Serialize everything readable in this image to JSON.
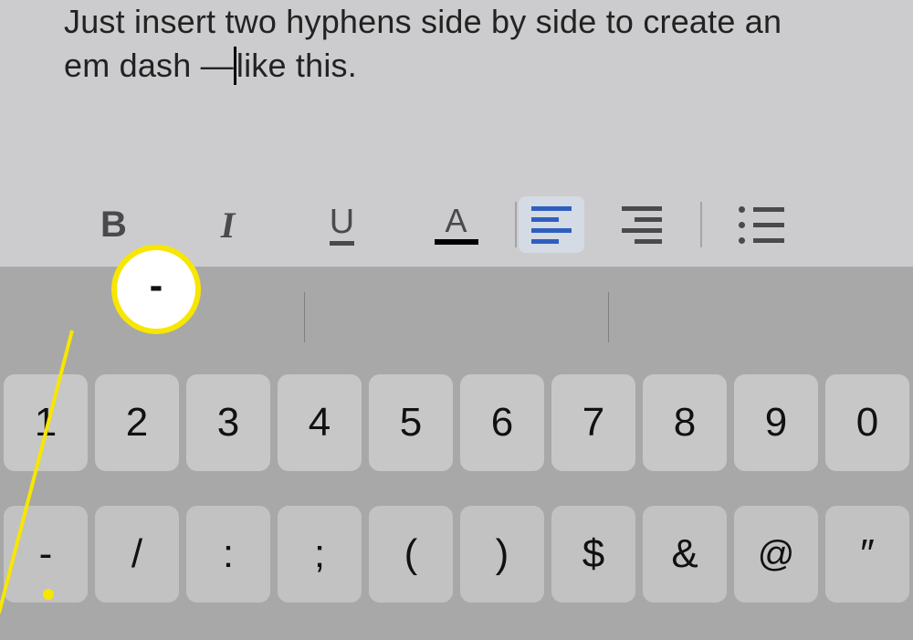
{
  "doc": {
    "line1": "Just insert two hyphens side by side to create an",
    "line2_before": "em dash —",
    "line2_after": "like this."
  },
  "toolbar": {
    "bold": "B",
    "italic": "I",
    "underline": "U",
    "text_color": "A"
  },
  "callout": {
    "symbol": "-"
  },
  "keyboard": {
    "row1": [
      "1",
      "2",
      "3",
      "4",
      "5",
      "6",
      "7",
      "8",
      "9",
      "0"
    ],
    "row2": [
      "-",
      "/",
      ":",
      ";",
      "(",
      ")",
      "$",
      "&",
      "@",
      "″"
    ]
  }
}
